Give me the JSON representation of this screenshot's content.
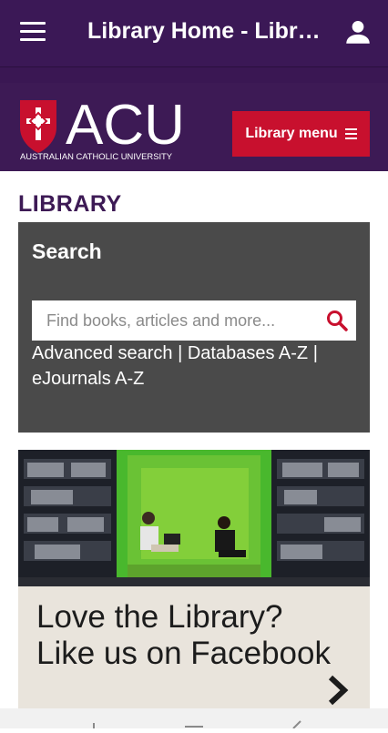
{
  "appbar": {
    "title": "Library Home - Library"
  },
  "header": {
    "logo_text": "ACU",
    "logo_subtitle": "AUSTRALIAN CATHOLIC UNIVERSITY",
    "menu_button_label": "Library menu"
  },
  "page": {
    "section_title": "LIBRARY"
  },
  "search": {
    "heading": "Search",
    "placeholder": "Find books, articles and more...",
    "links": [
      "Advanced search",
      "Databases A-Z",
      "eJournals A-Z"
    ],
    "separator": " | "
  },
  "promo": {
    "text": "Love the Library? Like us on Facebook"
  },
  "colors": {
    "brand_purple": "#3d1a55",
    "accent_red": "#c8102e",
    "panel_gray": "#4a4a4a",
    "promo_bg": "#e9e4dc"
  }
}
